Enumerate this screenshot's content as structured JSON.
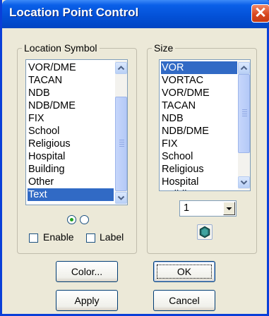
{
  "window": {
    "title": "Location Point Control",
    "close_glyph": "✕"
  },
  "location_symbol": {
    "legend": "Location Symbol",
    "items": [
      "VOR/DME",
      "TACAN",
      "NDB",
      "NDB/DME",
      "FIX",
      "School",
      "Religious",
      "Hospital",
      "Building",
      "Other",
      "Text"
    ],
    "selected": "Text",
    "enable_label": "Enable",
    "label_label": "Label"
  },
  "size": {
    "legend": "Size",
    "items": [
      "VOR",
      "VORTAC",
      "VOR/DME",
      "TACAN",
      "NDB",
      "NDB/DME",
      "FIX",
      "School",
      "Religious",
      "Hospital",
      "Building"
    ],
    "selected": "VOR",
    "combo_value": "1",
    "shape_icon": "hexagon-icon",
    "shape_color": "#2e7d7b"
  },
  "buttons": {
    "color": "Color...",
    "ok": "OK",
    "apply": "Apply",
    "cancel": "Cancel"
  },
  "colors": {
    "selection": "#316ac5",
    "title_bar": "#0350d6"
  }
}
